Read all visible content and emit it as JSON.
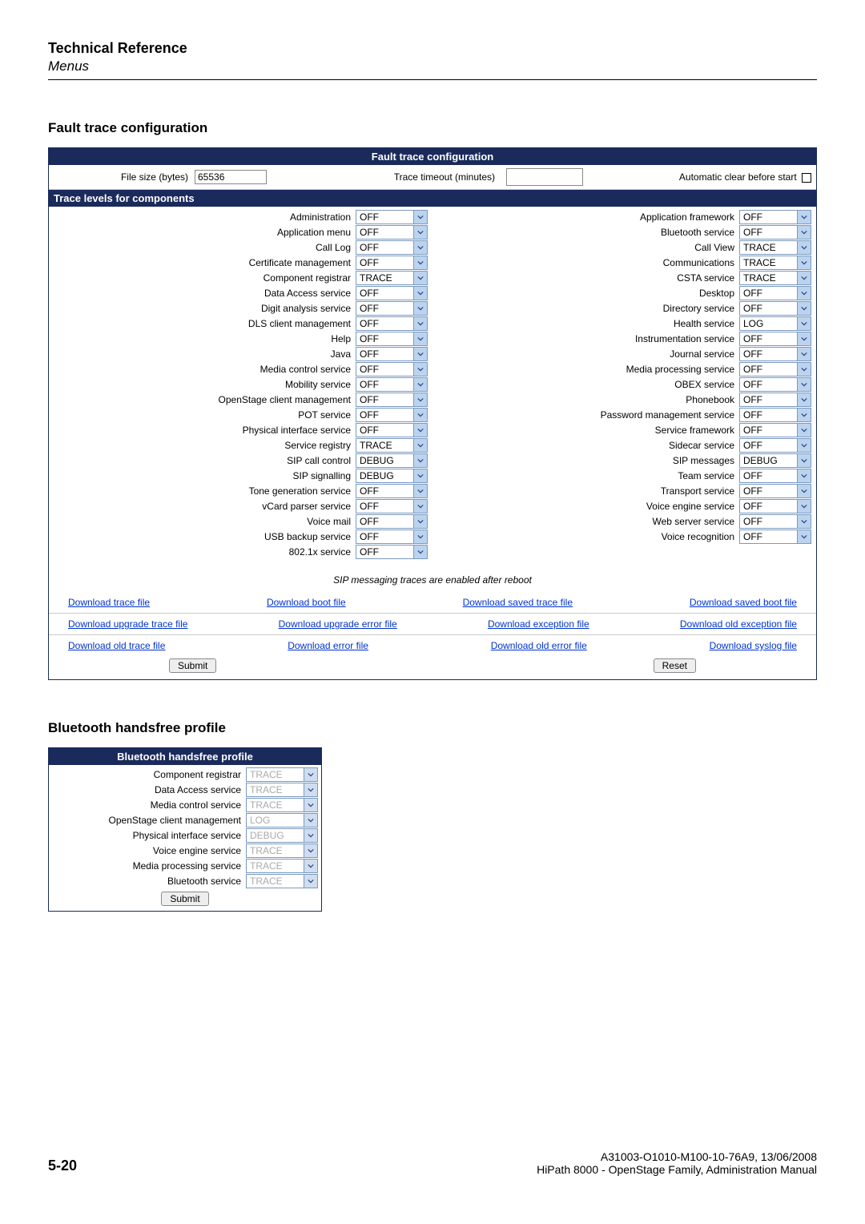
{
  "header": {
    "title": "Technical Reference",
    "subtitle": "Menus"
  },
  "section1": {
    "heading": "Fault trace configuration",
    "panel_title": "Fault trace configuration",
    "file_size_label": "File size (bytes)",
    "file_size_value": "65536",
    "trace_timeout_label": "Trace timeout (minutes)",
    "auto_clear_label": "Automatic clear before start",
    "trace_levels_header": "Trace levels for components",
    "components_left": [
      {
        "label": "Administration",
        "value": "OFF"
      },
      {
        "label": "Application menu",
        "value": "OFF"
      },
      {
        "label": "Call Log",
        "value": "OFF"
      },
      {
        "label": "Certificate management",
        "value": "OFF"
      },
      {
        "label": "Component registrar",
        "value": "TRACE"
      },
      {
        "label": "Data Access service",
        "value": "OFF"
      },
      {
        "label": "Digit analysis service",
        "value": "OFF"
      },
      {
        "label": "DLS client management",
        "value": "OFF"
      },
      {
        "label": "Help",
        "value": "OFF"
      },
      {
        "label": "Java",
        "value": "OFF"
      },
      {
        "label": "Media control service",
        "value": "OFF"
      },
      {
        "label": "Mobility service",
        "value": "OFF"
      },
      {
        "label": "OpenStage client management",
        "value": "OFF"
      },
      {
        "label": "POT service",
        "value": "OFF"
      },
      {
        "label": "Physical interface service",
        "value": "OFF"
      },
      {
        "label": "Service registry",
        "value": "TRACE"
      },
      {
        "label": "SIP call control",
        "value": "DEBUG"
      },
      {
        "label": "SIP signalling",
        "value": "DEBUG"
      },
      {
        "label": "Tone generation service",
        "value": "OFF"
      },
      {
        "label": "vCard parser service",
        "value": "OFF"
      },
      {
        "label": "Voice mail",
        "value": "OFF"
      },
      {
        "label": "USB backup service",
        "value": "OFF"
      },
      {
        "label": "802.1x service",
        "value": "OFF"
      }
    ],
    "components_right": [
      {
        "label": "Application framework",
        "value": "OFF"
      },
      {
        "label": "Bluetooth service",
        "value": "OFF"
      },
      {
        "label": "Call View",
        "value": "TRACE"
      },
      {
        "label": "Communications",
        "value": "TRACE"
      },
      {
        "label": "CSTA service",
        "value": "TRACE"
      },
      {
        "label": "Desktop",
        "value": "OFF"
      },
      {
        "label": "Directory service",
        "value": "OFF"
      },
      {
        "label": "Health service",
        "value": "LOG"
      },
      {
        "label": "Instrumentation service",
        "value": "OFF"
      },
      {
        "label": "Journal service",
        "value": "OFF"
      },
      {
        "label": "Media processing service",
        "value": "OFF"
      },
      {
        "label": "OBEX service",
        "value": "OFF"
      },
      {
        "label": "Phonebook",
        "value": "OFF"
      },
      {
        "label": "Password management service",
        "value": "OFF"
      },
      {
        "label": "Service framework",
        "value": "OFF"
      },
      {
        "label": "Sidecar service",
        "value": "OFF"
      },
      {
        "label": "SIP messages",
        "value": "DEBUG"
      },
      {
        "label": "Team service",
        "value": "OFF"
      },
      {
        "label": "Transport service",
        "value": "OFF"
      },
      {
        "label": "Voice engine service",
        "value": "OFF"
      },
      {
        "label": "Web server service",
        "value": "OFF"
      },
      {
        "label": "Voice recognition",
        "value": "OFF"
      }
    ],
    "note": "SIP messaging traces are enabled after reboot",
    "links1": [
      "Download trace file",
      "Download boot file",
      "Download saved trace file",
      "Download saved boot file"
    ],
    "links2": [
      "Download upgrade trace file",
      "Download upgrade error file",
      "Download exception file",
      "Download old exception file"
    ],
    "links3": [
      "Download old trace file",
      "Download error file",
      "Download old error file",
      "Download syslog file"
    ],
    "submit": "Submit",
    "reset": "Reset"
  },
  "section2": {
    "heading": "Bluetooth handsfree profile",
    "panel_title": "Bluetooth handsfree profile",
    "rows": [
      {
        "label": "Component registrar",
        "value": "TRACE"
      },
      {
        "label": "Data Access service",
        "value": "TRACE"
      },
      {
        "label": "Media control service",
        "value": "TRACE"
      },
      {
        "label": "OpenStage client management",
        "value": "LOG"
      },
      {
        "label": "Physical interface service",
        "value": "DEBUG"
      },
      {
        "label": "Voice engine service",
        "value": "TRACE"
      },
      {
        "label": "Media processing service",
        "value": "TRACE"
      },
      {
        "label": "Bluetooth service",
        "value": "TRACE"
      }
    ],
    "submit": "Submit"
  },
  "footer": {
    "docnum": "A31003-O1010-M100-10-76A9, 13/06/2008",
    "manual": "HiPath 8000 - OpenStage Family, Administration Manual",
    "page": "5-20"
  }
}
